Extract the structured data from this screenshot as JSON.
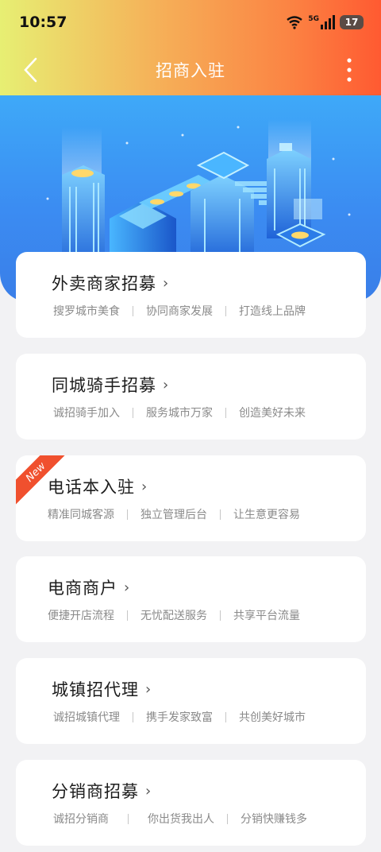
{
  "status_bar": {
    "time": "10:57",
    "network": "5G",
    "battery": "17"
  },
  "navbar": {
    "title": "招商入驻",
    "back_icon": "chevron-left-icon",
    "menu_icon": "more-vertical-icon"
  },
  "cards": [
    {
      "title": "外卖商家招募",
      "subs": [
        "搜罗城市美食",
        "协同商家发展",
        "打造线上品牌"
      ],
      "new": false
    },
    {
      "title": "同城骑手招募",
      "subs": [
        "诚招骑手加入",
        "服务城市万家",
        "创造美好未来"
      ],
      "new": false
    },
    {
      "title": "电话本入驻",
      "subs": [
        "精准同城客源",
        "独立管理后台",
        "让生意更容易"
      ],
      "new": true,
      "badge": "New"
    },
    {
      "title": "电商商户",
      "subs": [
        "便捷开店流程",
        "无忧配送服务",
        "共享平台流量"
      ],
      "new": false
    },
    {
      "title": "城镇招代理",
      "subs": [
        "诚招城镇代理",
        "携手发家致富",
        "共创美好城市"
      ],
      "new": false
    },
    {
      "title": "分销商招募",
      "subs": [
        "诚招分销商",
        "你出货我出人",
        "分销快赚钱多"
      ],
      "new": false
    }
  ],
  "colors": {
    "header_gradient": [
      "#e7ef73",
      "#f5b259",
      "#fb8544",
      "#ff5a31"
    ],
    "hero_blue": "#3b8cf2",
    "new_badge": "#f0502e"
  }
}
